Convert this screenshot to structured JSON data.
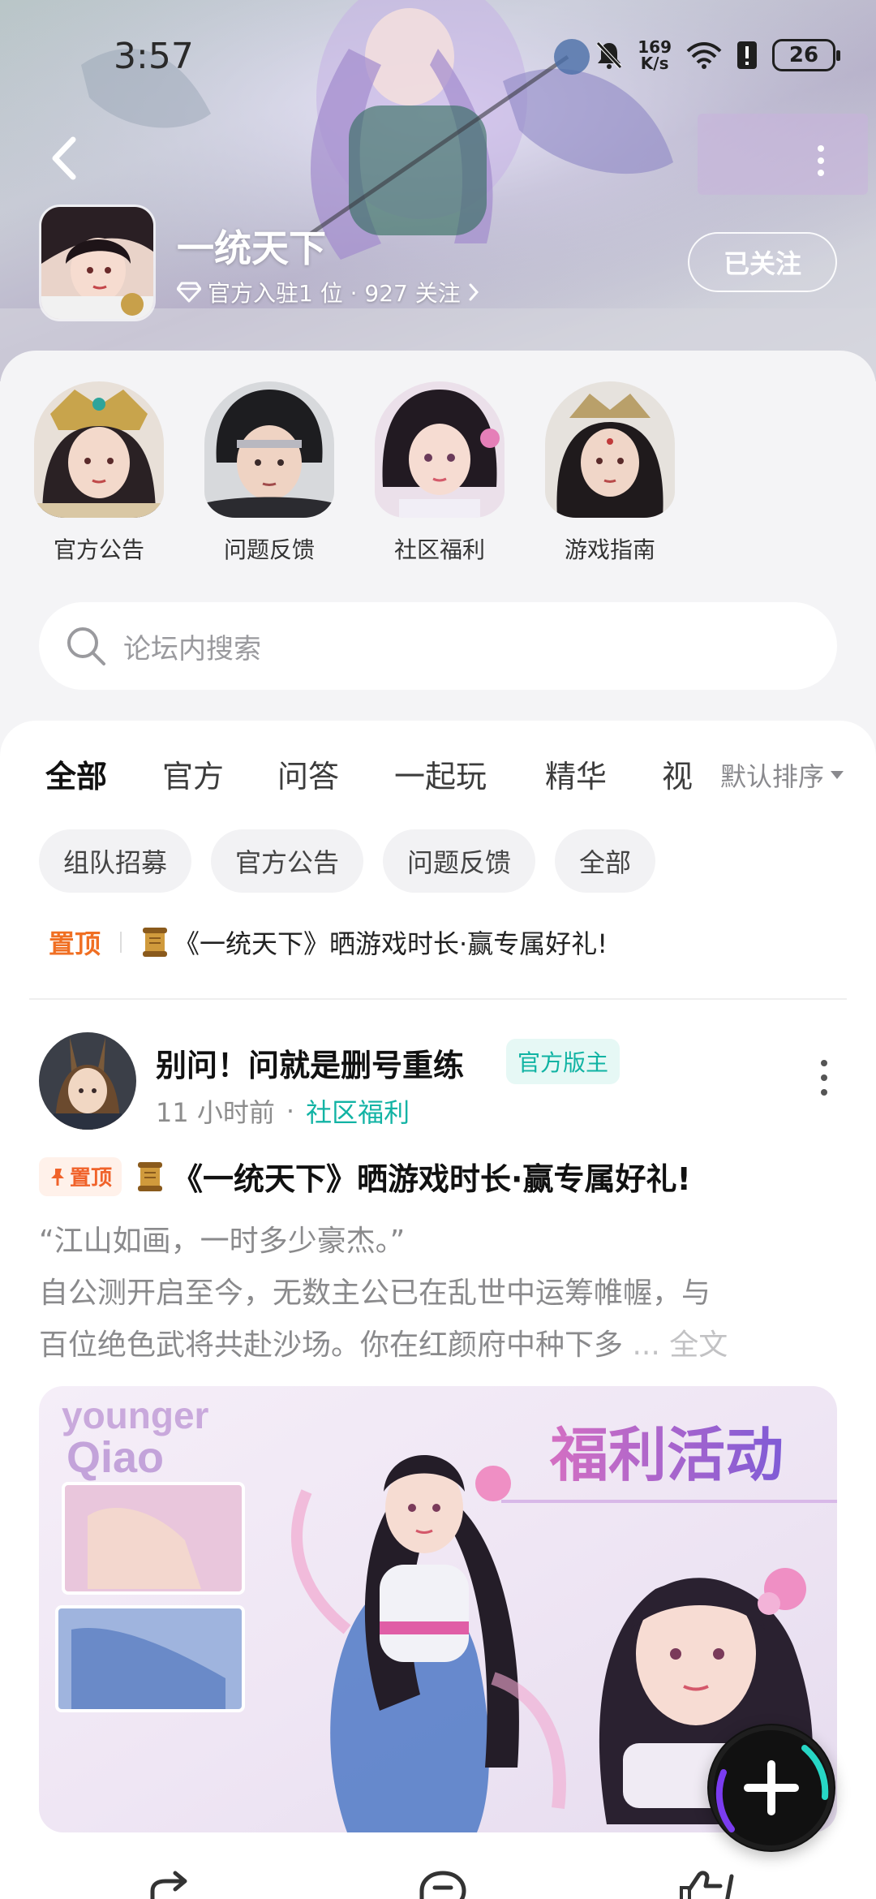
{
  "status_bar": {
    "time": "3:57",
    "net_speed_value": "169",
    "net_speed_unit": "K/s",
    "battery": "26"
  },
  "header": {
    "game_name": "一统天下",
    "meta_text": "官方入驻1 位 · 927 关注",
    "follow_label": "已关注"
  },
  "categories": [
    {
      "label": "官方公告"
    },
    {
      "label": "问题反馈"
    },
    {
      "label": "社区福利"
    },
    {
      "label": "游戏指南"
    }
  ],
  "search": {
    "placeholder": "论坛内搜索"
  },
  "tabs": {
    "items": [
      "全部",
      "官方",
      "问答",
      "一起玩",
      "精华",
      "视"
    ],
    "active": "全部",
    "sort_label": "默认排序"
  },
  "chips": [
    "组队招募",
    "官方公告",
    "问题反馈",
    "全部"
  ],
  "pinned": {
    "tag": "置顶",
    "title": "《一统天下》晒游戏时长·赢专属好礼!"
  },
  "post": {
    "author": "别问！问就是删号重练",
    "author_badge": "官方版主",
    "time": "11 小时前",
    "board": "社区福利",
    "top_badge": "置顶",
    "title": "《一统天下》晒游戏时长·赢专属好礼!",
    "body_line1": "“江山如画，一时多少豪杰。”",
    "body_line2": "自公测开启至今，无数主公已在乱世中运筹帷幄，与",
    "body_line3": "百位绝色武将共赴沙场。你在红颜府中种下多",
    "body_more": "... 全文",
    "image_text_left_1": "younger",
    "image_text_left_2": "Qiao",
    "image_text_title": "福利活动"
  },
  "colors": {
    "accent": "#14c4b8",
    "pinned_orange": "#f06f23",
    "badge_teal": "#10b3a3"
  },
  "icons": [
    "back-icon",
    "more-icon",
    "diamond-icon",
    "chevron-right-icon",
    "search-icon",
    "scroll-icon",
    "pin-icon",
    "plus-icon",
    "share-icon",
    "comment-icon",
    "like-icon"
  ]
}
